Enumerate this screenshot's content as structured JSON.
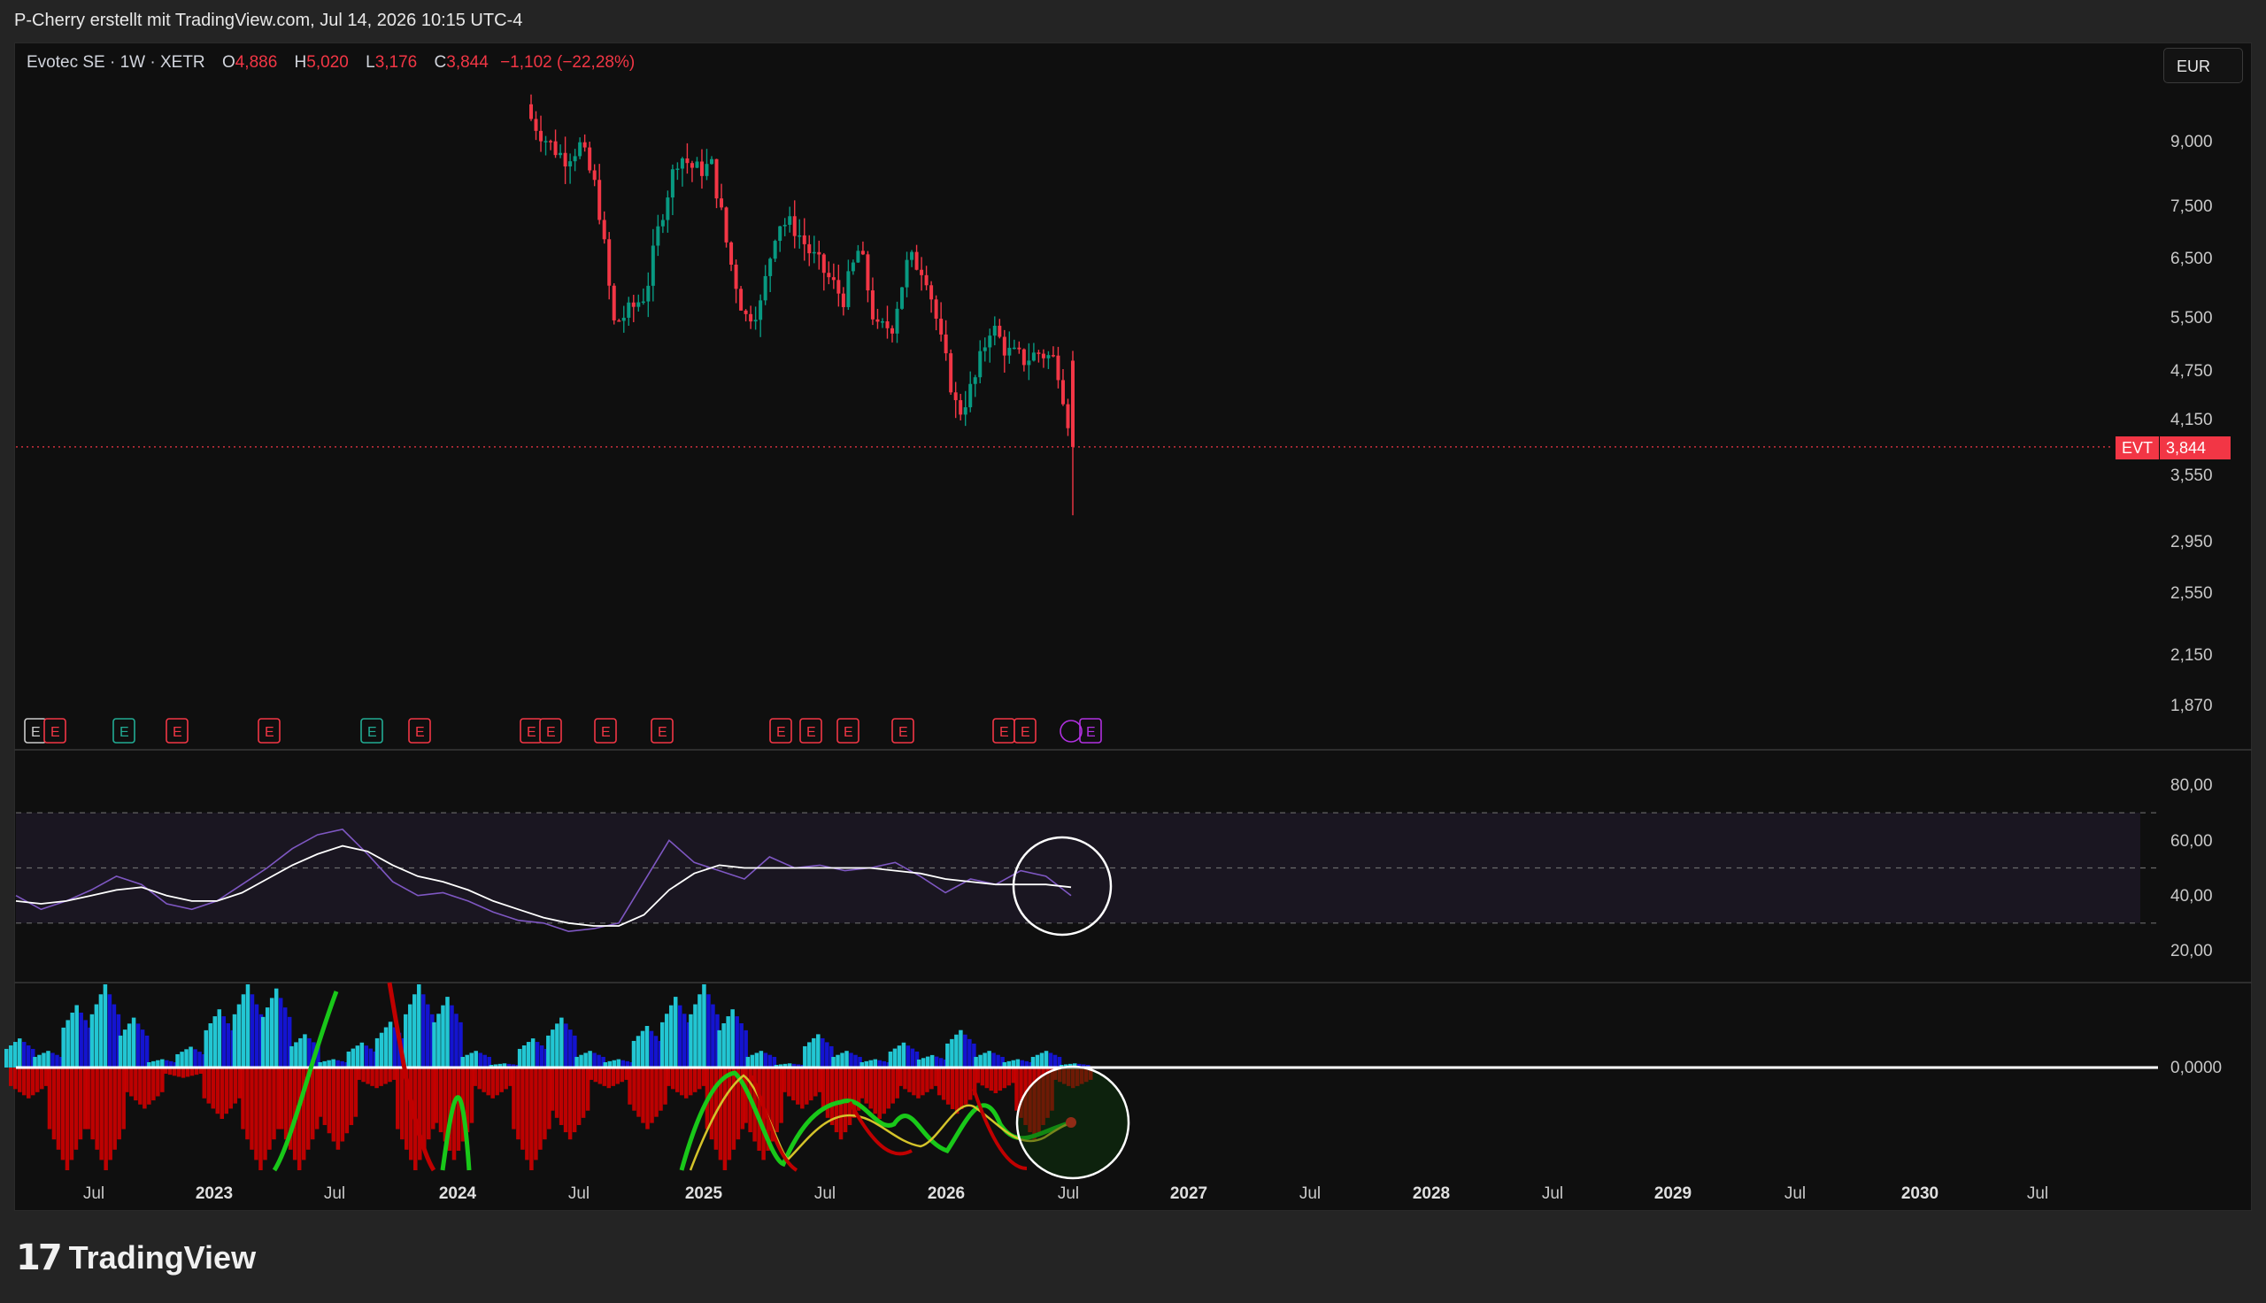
{
  "header": {
    "credit": "P-Cherry erstellt mit TradingView.com, Jul 14, 2026 10:15 UTC-4"
  },
  "legend": {
    "symbol": "Evotec SE · 1W · XETR",
    "o_label": "O",
    "o_value": "4,886",
    "h_label": "H",
    "h_value": "5,020",
    "l_label": "L",
    "l_value": "3,176",
    "c_label": "C",
    "c_value": "3,844",
    "change": "−1,102 (−22,28%)"
  },
  "currency": "EUR",
  "price_tag": {
    "ticker": "EVT",
    "value": "3,844"
  },
  "footer": {
    "brand": "TradingView"
  },
  "colors": {
    "up": "#089981",
    "down": "#f23645",
    "rsi": "#7e57c2",
    "rsi_ma": "#ffffff",
    "hist_cyan": "#22c6d3",
    "hist_blue": "#1414d0",
    "hist_red": "#d00000",
    "wave_green": "#19c819",
    "wave_yellow": "#d4c32a"
  },
  "chart_data": [
    {
      "type": "candlestick",
      "title": "Evotec SE · 1W · XETR",
      "scale": "log",
      "y_ticks": [
        "9,000",
        "7,500",
        "6,500",
        "5,500",
        "4,750",
        "4,150",
        "3,550",
        "2,950",
        "2,550",
        "2,150",
        "1,870"
      ],
      "y_tick_values": [
        9.0,
        7.5,
        6.5,
        5.5,
        4.75,
        4.15,
        3.55,
        2.95,
        2.55,
        2.15,
        1.87
      ],
      "x_ticks": [
        "Jul",
        "2023",
        "Jul",
        "2024",
        "Jul",
        "2025",
        "Jul",
        "2026",
        "Jul",
        "2027",
        "Jul",
        "2028",
        "Jul",
        "2029",
        "Jul",
        "2030",
        "Jul"
      ],
      "last_close": 3.844,
      "ohlc_anchor_closes": [
        9.6,
        9.0,
        8.6,
        8.9,
        7.8,
        5.4,
        5.6,
        5.9,
        7.4,
        8.7,
        8.3,
        8.4,
        6.6,
        5.5,
        5.7,
        7.2,
        7.1,
        6.6,
        6.2,
        5.8,
        6.7,
        5.3,
        5.4,
        6.5,
        6.3,
        5.1,
        4.2,
        4.6,
        5.4,
        5.0,
        4.9,
        5.0,
        4.886,
        3.844
      ]
    },
    {
      "type": "line",
      "title": "",
      "y_ticks": [
        "80,00",
        "60,00",
        "40,00",
        "20,00"
      ],
      "y_tick_values": [
        80,
        60,
        40,
        20
      ],
      "bands": [
        30,
        50,
        70
      ],
      "series": [
        {
          "values": [
            40,
            35,
            38,
            42,
            47,
            44,
            37,
            35,
            38,
            44,
            50,
            57,
            62,
            64,
            55,
            45,
            40,
            41,
            38,
            34,
            31,
            30,
            27,
            28,
            30,
            45,
            60,
            52,
            49,
            46,
            54,
            50,
            51,
            49,
            50,
            52,
            47,
            41,
            46,
            44,
            49,
            47,
            40
          ]
        },
        {
          "values": [
            38,
            37,
            38,
            40,
            42,
            43,
            40,
            38,
            38,
            41,
            46,
            51,
            55,
            58,
            56,
            51,
            47,
            45,
            42,
            38,
            35,
            32,
            30,
            29,
            29,
            33,
            42,
            48,
            51,
            50,
            50,
            50,
            50,
            50,
            50,
            49,
            48,
            46,
            45,
            44,
            44,
            44,
            43
          ]
        }
      ]
    },
    {
      "type": "bar",
      "title": "",
      "y_ticks": [
        "0,0000"
      ],
      "series": [
        {
          "values": [
            0.35,
            0.2,
            0.75,
            1.0,
            0.6,
            0.1,
            0.25,
            0.7,
            1.0,
            0.95,
            0.4,
            0.1,
            0.3,
            0.55,
            1.0,
            0.85,
            0.2,
            0.05,
            0.35,
            0.6,
            0.2,
            0.1,
            0.5,
            0.85,
            1.0,
            0.7,
            0.2,
            0.05,
            0.4,
            0.2,
            0.1,
            0.3,
            0.15,
            0.45,
            0.2,
            0.1,
            0.2,
            0.05
          ]
        },
        {
          "values": [
            -0.3,
            -1.0,
            -1.0,
            -0.4,
            -0.1,
            -0.5,
            -1.0,
            -1.0,
            -0.8,
            -0.2,
            -1.0,
            -0.9,
            -0.3,
            -1.0,
            -0.7,
            -0.2,
            -0.6,
            -0.3,
            -1.0,
            -0.9,
            -0.4,
            -0.7,
            -0.5,
            -0.3,
            -0.45,
            -0.25,
            -0.7,
            -0.2
          ]
        }
      ]
    }
  ]
}
